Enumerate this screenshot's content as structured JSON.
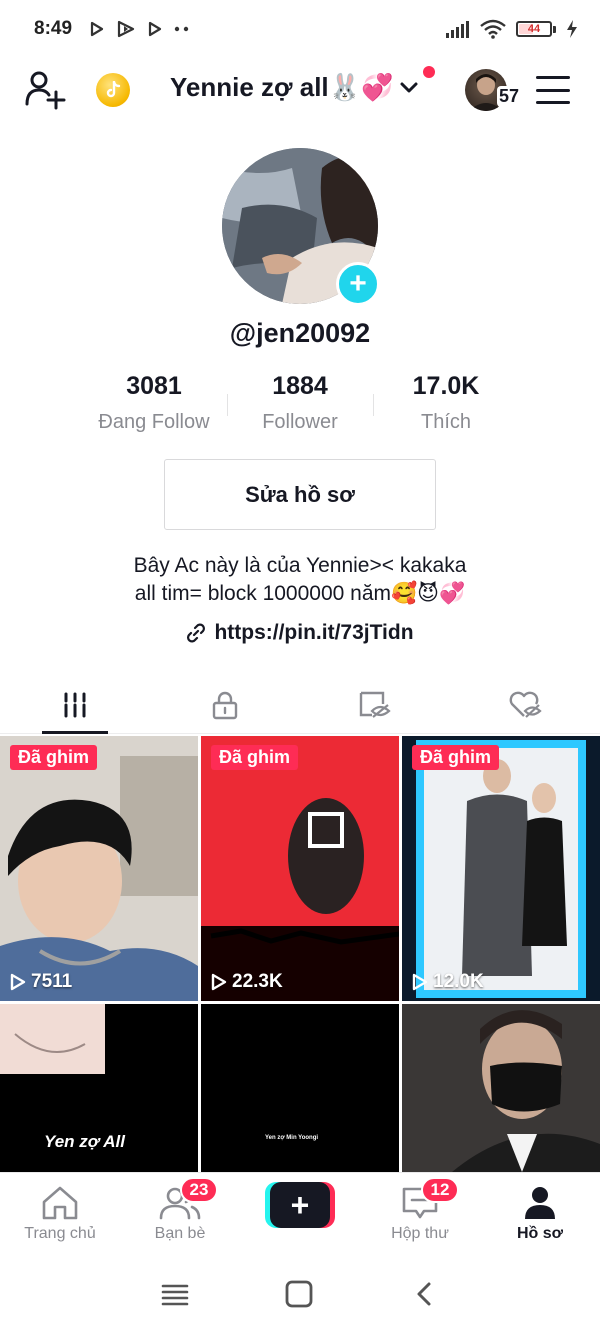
{
  "status_bar": {
    "time": "8:49",
    "battery": "44",
    "battery_level": 0.44
  },
  "header": {
    "title": "Yennie zợ all🐰💞",
    "friend_count": "57"
  },
  "profile": {
    "username": "@jen20092",
    "stats": [
      {
        "value": "3081",
        "label": "Đang Follow"
      },
      {
        "value": "1884",
        "label": "Follower"
      },
      {
        "value": "17.0K",
        "label": "Thích"
      }
    ],
    "edit_button": "Sửa hồ sơ",
    "bio_line1": "Bây Ac này là của Yennie>< kakaka",
    "bio_line2": "all tim= block 1000000 năm🥰😈💞",
    "link": "https://pin.it/73jTidn"
  },
  "videos": [
    {
      "pinned": "Đã ghim",
      "views": "7511"
    },
    {
      "pinned": "Đã ghim",
      "views": "22.3K"
    },
    {
      "pinned": "Đã ghim",
      "views": "12.0K"
    },
    {
      "caption": "Yen zợ All"
    },
    {
      "caption": "Yen zợ Min Yoongi"
    },
    {}
  ],
  "bottom_nav": {
    "home": "Trang chủ",
    "friends": "Bạn bè",
    "friends_badge": "23",
    "inbox": "Hộp thư",
    "inbox_badge": "12",
    "profile": "Hồ sơ"
  },
  "colors": {
    "accent": "#fe2c55",
    "cyan": "#25f4ee",
    "text": "#161823",
    "muted": "#8a8b91"
  }
}
